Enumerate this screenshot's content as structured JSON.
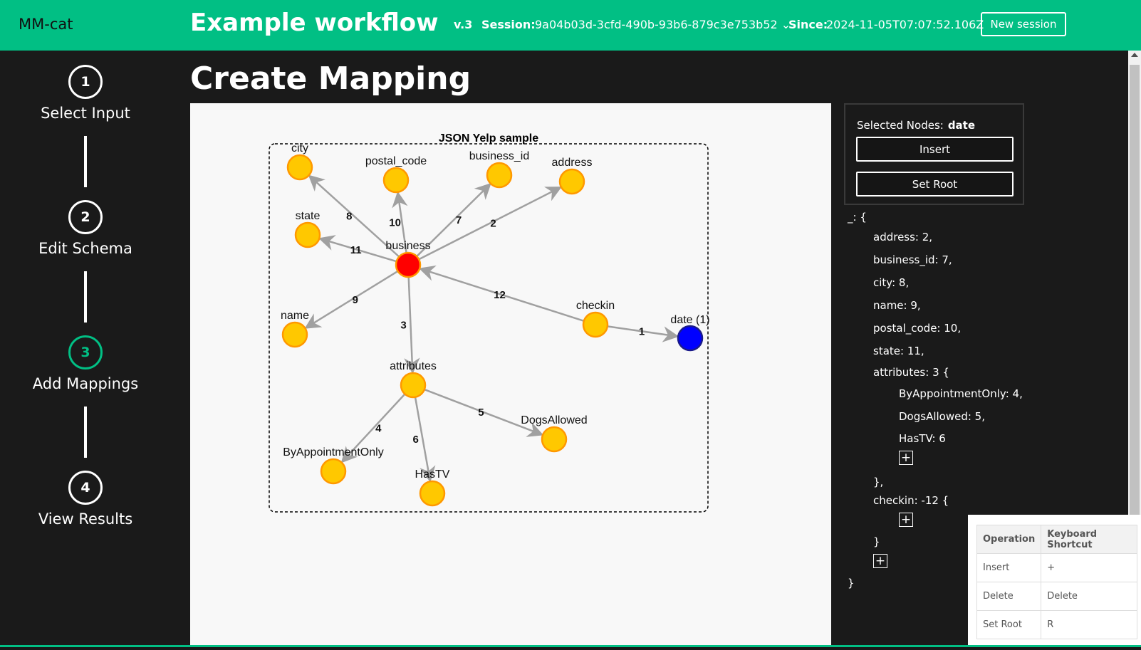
{
  "header": {
    "app_name": "MM-cat",
    "workflow_title": "Example workflow",
    "version": "v.3",
    "session_label": "Session:",
    "session_id": "9a04b03d-3cfd-490b-93b6-879c3e753b52",
    "since_label": "Since:",
    "since_value": "2024-11-05T07:07:52.106Z",
    "new_session_label": "New session"
  },
  "steps": [
    {
      "number": "1",
      "label": "Select Input"
    },
    {
      "number": "2",
      "label": "Edit Schema"
    },
    {
      "number": "3",
      "label": "Add Mappings"
    },
    {
      "number": "4",
      "label": "View Results"
    }
  ],
  "page_title": "Create Mapping",
  "graph": {
    "title": "JSON Yelp sample",
    "nodes": [
      {
        "label": "business"
      },
      {
        "label": "city"
      },
      {
        "label": "postal_code"
      },
      {
        "label": "business_id"
      },
      {
        "label": "address"
      },
      {
        "label": "state"
      },
      {
        "label": "name"
      },
      {
        "label": "attributes"
      },
      {
        "label": "checkin"
      },
      {
        "label": "date (1)"
      },
      {
        "label": "ByAppointmentOnly"
      },
      {
        "label": "HasTV"
      },
      {
        "label": "DogsAllowed"
      }
    ],
    "edges": [
      {
        "from": "business",
        "to": "city",
        "label": "8"
      },
      {
        "from": "business",
        "to": "postal_code",
        "label": "10"
      },
      {
        "from": "business",
        "to": "business_id",
        "label": "7"
      },
      {
        "from": "business",
        "to": "address",
        "label": "2"
      },
      {
        "from": "business",
        "to": "state",
        "label": "11"
      },
      {
        "from": "business",
        "to": "name",
        "label": "9"
      },
      {
        "from": "business",
        "to": "attributes",
        "label": "3"
      },
      {
        "from": "checkin",
        "to": "business",
        "label": "12"
      },
      {
        "from": "checkin",
        "to": "date (1)",
        "label": "1"
      },
      {
        "from": "attributes",
        "to": "ByAppointmentOnly",
        "label": "4"
      },
      {
        "from": "attributes",
        "to": "HasTV",
        "label": "6"
      },
      {
        "from": "attributes",
        "to": "DogsAllowed",
        "label": "5"
      }
    ],
    "colors": {
      "root": "#ff0000",
      "selected": "#0000ff",
      "default": "#ffc800",
      "border": "#ff9800",
      "edge": "#a0a0a0"
    }
  },
  "panel": {
    "selected_label": "Selected Nodes:",
    "selected_value": "date",
    "insert_label": "Insert",
    "set_root_label": "Set Root"
  },
  "tree": {
    "lines": [
      "_: {",
      "address: 2,",
      "business_id: 7,",
      "city: 8,",
      "name: 9,",
      "postal_code: 10,",
      "state: 11,",
      "attributes: 3 {",
      "ByAppointmentOnly: 4,",
      "DogsAllowed: 5,",
      "HasTV: 6",
      "},",
      "checkin: -12 {",
      "}",
      "}"
    ],
    "plus_symbol": "+"
  },
  "shortcuts": {
    "headers": [
      "Operation",
      "Keyboard Shortcut"
    ],
    "rows": [
      [
        "Insert",
        "+"
      ],
      [
        "Delete",
        "Delete"
      ],
      [
        "Set Root",
        "R"
      ]
    ]
  }
}
